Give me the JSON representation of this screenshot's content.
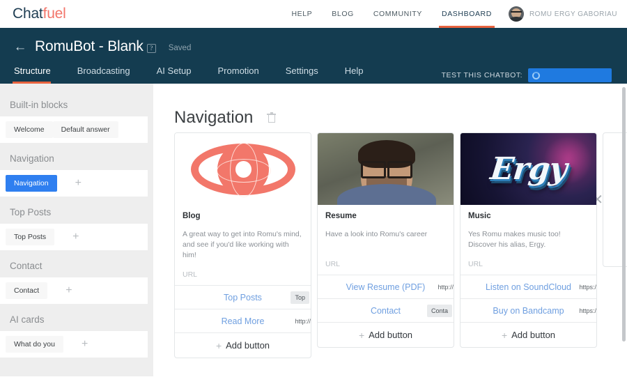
{
  "brand": {
    "part1": "Chat",
    "part2": "fuel",
    "color1": "#1e3d52",
    "color2": "#f2756a"
  },
  "topnav": {
    "items": [
      {
        "label": "HELP",
        "active": false
      },
      {
        "label": "BLOG",
        "active": false
      },
      {
        "label": "COMMUNITY",
        "active": false
      },
      {
        "label": "DASHBOARD",
        "active": true
      }
    ],
    "username": "ROMU ERGY GABORIAU",
    "avatar_name": "avatar"
  },
  "bot_header": {
    "back_arrow": "←",
    "bot_name": "RomuBot - Blank",
    "help_glyph": "?",
    "saved_label": "Saved",
    "test_label": "TEST THIS CHATBOT:",
    "accent_color": "#e8633f",
    "background": "#143c50",
    "tabs": [
      {
        "label": "Structure",
        "active": true
      },
      {
        "label": "Broadcasting",
        "active": false
      },
      {
        "label": "AI Setup",
        "active": false
      },
      {
        "label": "Promotion",
        "active": false
      },
      {
        "label": "Settings",
        "active": false
      },
      {
        "label": "Help",
        "active": false
      }
    ]
  },
  "sidebar": {
    "groups": [
      {
        "title": "Built-in blocks",
        "chips": [
          {
            "label": "Welcome",
            "active": false
          },
          {
            "label": "Default answer",
            "active": false
          }
        ],
        "plus": false
      },
      {
        "title": "Navigation",
        "chips": [
          {
            "label": "Navigation",
            "active": true
          }
        ],
        "plus": true
      },
      {
        "title": "Top Posts",
        "chips": [
          {
            "label": "Top Posts",
            "active": false
          }
        ],
        "plus": true
      },
      {
        "title": "Contact",
        "chips": [
          {
            "label": "Contact",
            "active": false
          }
        ],
        "plus": true
      },
      {
        "title": "AI cards",
        "chips": [
          {
            "label": "What do you",
            "active": false
          }
        ],
        "plus": true
      }
    ],
    "plus_glyph": "+"
  },
  "main": {
    "title": "Navigation",
    "delete_icon": "trash-icon",
    "close_glyph": "✕",
    "url_placeholder": "URL",
    "add_button_label": "Add button",
    "add_button_plus": "+",
    "cards": [
      {
        "art": "eye",
        "title": "Blog",
        "description": "A great way to get into Romu's mind, and see if you'd like working with him!",
        "url": "URL",
        "buttons": [
          {
            "label": "Top Posts",
            "meta": "Top",
            "meta_type": "badge"
          },
          {
            "label": "Read More",
            "meta": "http://",
            "meta_type": "text"
          }
        ]
      },
      {
        "art": "portrait",
        "title": "Resume",
        "description": "Have a look into Romu's career",
        "url": "URL",
        "buttons": [
          {
            "label": "View Resume (PDF)",
            "meta": "http://",
            "meta_type": "text"
          },
          {
            "label": "Contact",
            "meta": "Conta",
            "meta_type": "badge"
          }
        ]
      },
      {
        "art": "ergy",
        "title": "Music",
        "description": "Yes Romu makes music too! Discover his alias, Ergy.",
        "url": "URL",
        "art_text": "Ergy",
        "buttons": [
          {
            "label": "Listen on SoundCloud",
            "meta": "https:/",
            "meta_type": "text"
          },
          {
            "label": "Buy on Bandcamp",
            "meta": "https:/",
            "meta_type": "text"
          }
        ]
      },
      {
        "art": "empty",
        "title": "",
        "description": "",
        "url": "",
        "buttons": []
      }
    ]
  }
}
